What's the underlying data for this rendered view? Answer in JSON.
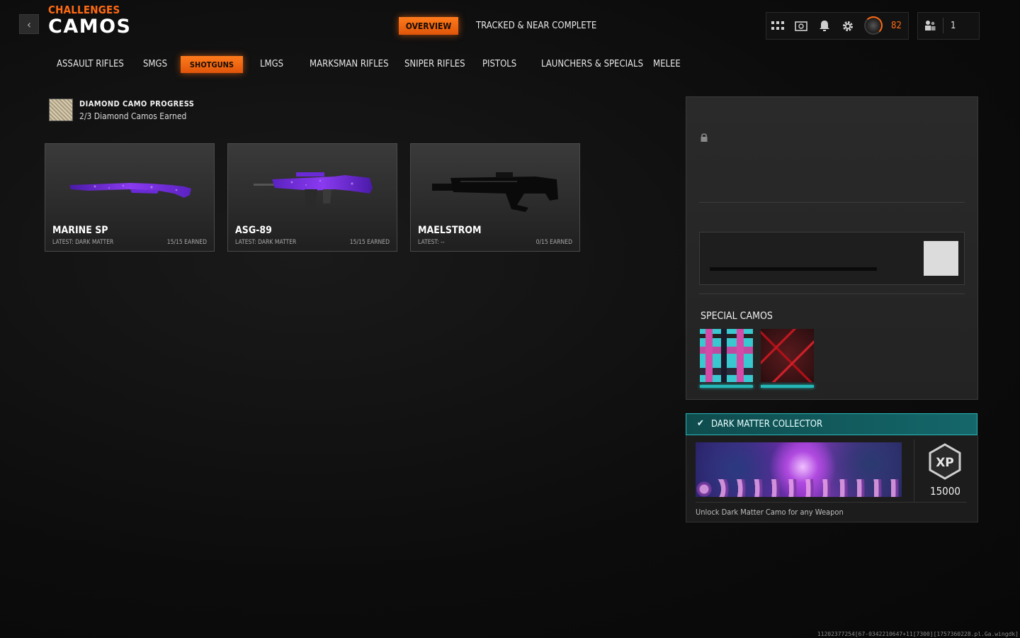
{
  "header": {
    "subtitle": "CHALLENGES",
    "title": "CAMOS",
    "back_label": "‹",
    "tabs": [
      {
        "label": "OVERVIEW",
        "active": true
      },
      {
        "label": "TRACKED & NEAR COMPLETE",
        "active": false
      }
    ],
    "player_level": "82",
    "party_count": "1",
    "icons": [
      "grid-icon",
      "challenges-icon",
      "bell-icon",
      "gear-icon",
      "profile-level-icon",
      "party-icon"
    ]
  },
  "categories": [
    {
      "label": "ASSAULT RIFLES",
      "active": false
    },
    {
      "label": "SMGS",
      "active": false
    },
    {
      "label": "SHOTGUNS",
      "active": true
    },
    {
      "label": "LMGS",
      "active": false
    },
    {
      "label": "MARKSMAN RIFLES",
      "active": false
    },
    {
      "label": "SNIPER RIFLES",
      "active": false
    },
    {
      "label": "PISTOLS",
      "active": false
    },
    {
      "label": "LAUNCHERS & SPECIALS",
      "active": false
    },
    {
      "label": "MELEE",
      "active": false
    }
  ],
  "diamond_progress": {
    "title": "DIAMOND CAMO PROGRESS",
    "subtitle": "2/3 Diamond Camos Earned"
  },
  "weapons": [
    {
      "name": "MARINE SP",
      "latest": "LATEST: DARK MATTER",
      "earned": "15/15 EARNED",
      "camo": "dark-matter"
    },
    {
      "name": "ASG-89",
      "latest": "LATEST: DARK MATTER",
      "earned": "15/15 EARNED",
      "camo": "dark-matter"
    },
    {
      "name": "MAELSTROM",
      "latest": "LATEST: --",
      "earned": "0/15 EARNED",
      "camo": "none"
    }
  ],
  "details_panel": {
    "special_camos_title": "SPECIAL CAMOS"
  },
  "reward": {
    "title": "DARK MATTER COLLECTOR",
    "xp": "15000",
    "description": "Unlock Dark Matter Camo for any Weapon"
  },
  "footer_id": "11202377254[67-0342210647+11[7300][1757360228.pl.Ga.wingdk]",
  "colors": {
    "accent": "#ff6a13",
    "teal": "#24b8b8",
    "dark_matter": "#7a2ad8"
  }
}
